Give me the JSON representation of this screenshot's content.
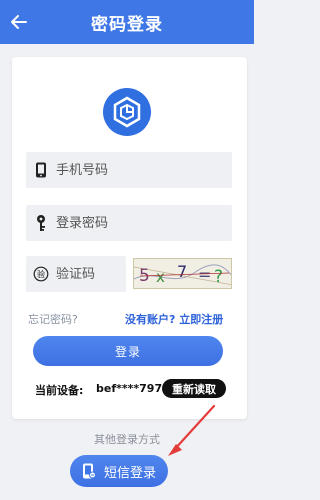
{
  "header": {
    "title": "密码登录",
    "back_icon": "arrow-left-icon"
  },
  "form": {
    "phone_placeholder": "手机号码",
    "password_placeholder": "登录密码",
    "captcha_placeholder": "验证码",
    "captcha_text": "5 x 7 = ?"
  },
  "links": {
    "forgot": "忘记密码?",
    "register": "没有账户? 立即注册"
  },
  "buttons": {
    "login": "登录",
    "reread": "重新读取",
    "sms_login": "短信登录"
  },
  "device": {
    "label": "当前设备:",
    "value": "bef****7975"
  },
  "other_login": "其他登录方式",
  "colors": {
    "primary": "#3f78e6",
    "annotation_arrow": "#e43b3b"
  }
}
